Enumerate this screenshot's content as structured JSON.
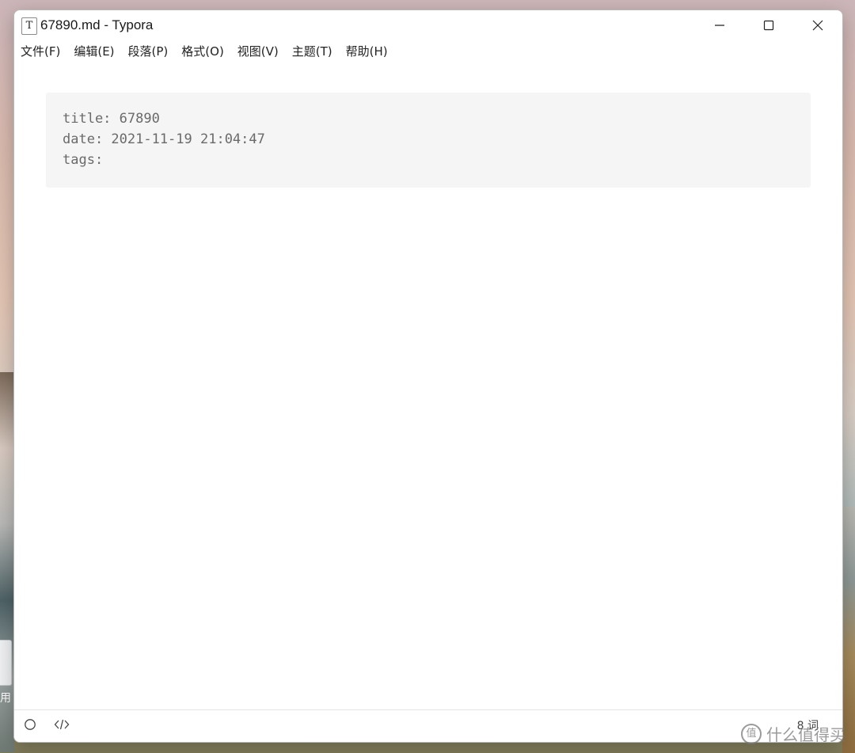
{
  "window": {
    "title": "67890.md - Typora",
    "app_icon_glyph": "T",
    "buttons": {
      "minimize": "minimize-icon",
      "maximize": "maximize-icon",
      "close": "close-icon"
    }
  },
  "menu": {
    "items": [
      {
        "label": "文件(F)"
      },
      {
        "label": "编辑(E)"
      },
      {
        "label": "段落(P)"
      },
      {
        "label": "格式(O)"
      },
      {
        "label": "视图(V)"
      },
      {
        "label": "主题(T)"
      },
      {
        "label": "帮助(H)"
      }
    ]
  },
  "editor": {
    "front_matter": {
      "line1": "title: 67890",
      "line2": "date: 2021-11-19 21:04:47",
      "line3": "tags:"
    }
  },
  "statusbar": {
    "sidebar_icon": "circle-icon",
    "source_icon": "code-icon",
    "word_count": "8 词"
  },
  "desktop": {
    "file_label": "用",
    "watermark": "什么值得买",
    "watermark_logo": "值"
  },
  "colors": {
    "window_bg": "#ffffff",
    "front_matter_bg": "#f5f5f5",
    "front_matter_text": "#6a6a6a"
  }
}
